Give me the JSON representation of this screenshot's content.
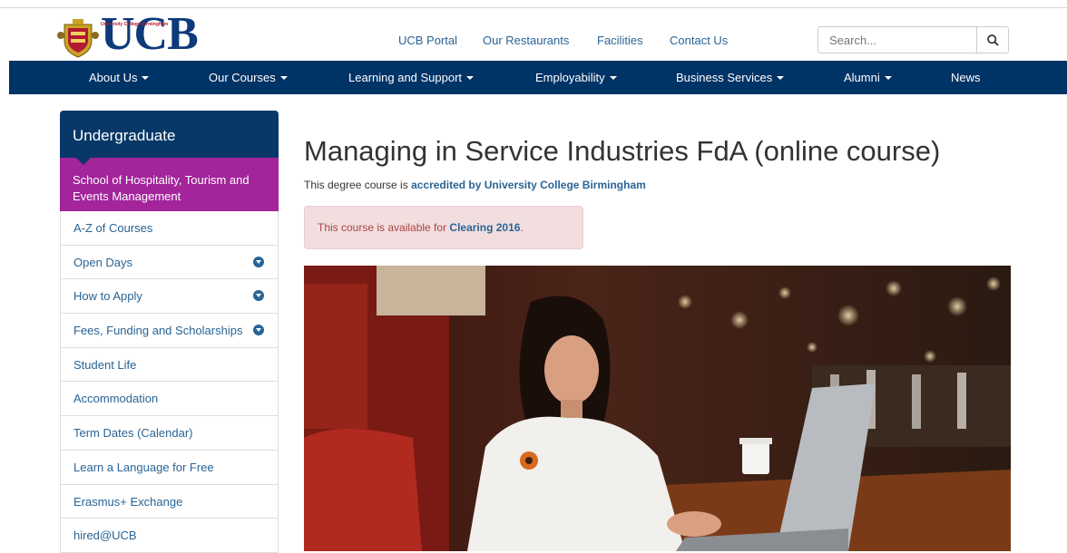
{
  "header": {
    "logo_text": "UCB",
    "logo_subtext": "University College Birmingham",
    "top_links": [
      "UCB Portal",
      "Our Restaurants",
      "Facilities",
      "Contact Us"
    ],
    "search_placeholder": "Search..."
  },
  "nav": {
    "items": [
      {
        "label": "About Us",
        "dropdown": true
      },
      {
        "label": "Our Courses",
        "dropdown": true
      },
      {
        "label": "Learning and Support",
        "dropdown": true
      },
      {
        "label": "Employability",
        "dropdown": true
      },
      {
        "label": "Business Services",
        "dropdown": true
      },
      {
        "label": "Alumni",
        "dropdown": true
      },
      {
        "label": "News",
        "dropdown": false
      }
    ]
  },
  "sidebar": {
    "heading": "Undergraduate",
    "active_item": "School of Hospitality, Tourism and Events Management",
    "items": [
      {
        "label": "A-Z of Courses",
        "expandable": false
      },
      {
        "label": "Open Days",
        "expandable": true
      },
      {
        "label": "How to Apply",
        "expandable": true
      },
      {
        "label": "Fees, Funding and Scholarships",
        "expandable": true
      },
      {
        "label": "Student Life",
        "expandable": false
      },
      {
        "label": "Accommodation",
        "expandable": false
      },
      {
        "label": "Term Dates (Calendar)",
        "expandable": false
      },
      {
        "label": "Learn a Language for Free",
        "expandable": false
      },
      {
        "label": "Erasmus+ Exchange",
        "expandable": false
      },
      {
        "label": "hired@UCB",
        "expandable": false
      }
    ]
  },
  "main": {
    "title": "Managing in Service Industries FdA (online course)",
    "intro_prefix": "This degree course is ",
    "intro_link": "accredited by University College Birmingham",
    "alert_prefix": "This course is available for ",
    "alert_link": "Clearing 2016",
    "alert_suffix": "."
  },
  "colors": {
    "navy": "#003366",
    "purple": "#a3249b",
    "link": "#2a6496",
    "alert_bg": "#f2dede"
  }
}
